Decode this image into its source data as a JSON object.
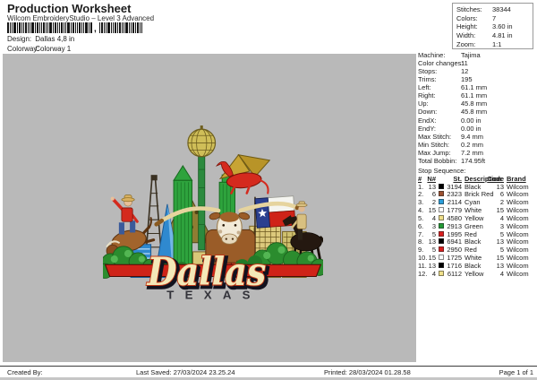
{
  "header": {
    "title": "Production Worksheet",
    "subtitle": "Wilcom EmbroideryStudio – Level 3 Advanced",
    "barcode_comma": ",",
    "design_label": "Design:",
    "design_value": "Dallas 4,8 in",
    "colorway_label": "Colorway:",
    "colorway_value": "Colorway 1"
  },
  "summary": {
    "rows": [
      {
        "label": "Stitches:",
        "value": "38344"
      },
      {
        "label": "Colors:",
        "value": "7"
      },
      {
        "label": "Height:",
        "value": "3.60 in"
      },
      {
        "label": "Width:",
        "value": "4.81 in"
      },
      {
        "label": "Zoom:",
        "value": "1:1"
      }
    ]
  },
  "machine": {
    "rows": [
      {
        "label": "Machine:",
        "value": "Tajima"
      },
      {
        "label": "Color changes:",
        "value": "11"
      },
      {
        "label": "Stops:",
        "value": "12"
      },
      {
        "label": "Trims:",
        "value": "195"
      },
      {
        "label": "Left:",
        "value": "61.1 mm"
      },
      {
        "label": "Right:",
        "value": "61.1 mm"
      },
      {
        "label": "Up:",
        "value": "45.8 mm"
      },
      {
        "label": "Down:",
        "value": "45.8 mm"
      },
      {
        "label": "EndX:",
        "value": "0.00 in"
      },
      {
        "label": "EndY:",
        "value": "0.00 in"
      },
      {
        "label": "Max Stitch:",
        "value": "9.4 mm"
      },
      {
        "label": "Min Stitch:",
        "value": "0.2 mm"
      },
      {
        "label": "Max Jump:",
        "value": "7.2 mm"
      },
      {
        "label": "Total Bobbin:",
        "value": "174.95ft"
      }
    ]
  },
  "stop_sequence": {
    "title": "Stop Sequence:",
    "headers": {
      "num": "#",
      "n": "N#",
      "st": "St.",
      "description": "Description",
      "code": "Code",
      "brand": "Brand"
    },
    "rows": [
      {
        "num": "1.",
        "n": "13",
        "hex": "#000000",
        "st": "3194",
        "description": "Black",
        "code": "13",
        "brand": "Wilcom"
      },
      {
        "num": "2.",
        "n": "6",
        "hex": "#9c5030",
        "st": "2323",
        "description": "Brick Red",
        "code": "6",
        "brand": "Wilcom"
      },
      {
        "num": "3.",
        "n": "2",
        "hex": "#2b9fdc",
        "st": "2114",
        "description": "Cyan",
        "code": "2",
        "brand": "Wilcom"
      },
      {
        "num": "4.",
        "n": "15",
        "hex": "#ffffff",
        "st": "1779",
        "description": "White",
        "code": "15",
        "brand": "Wilcom"
      },
      {
        "num": "5.",
        "n": "4",
        "hex": "#f0e08a",
        "st": "4580",
        "description": "Yellow",
        "code": "4",
        "brand": "Wilcom"
      },
      {
        "num": "6.",
        "n": "3",
        "hex": "#219a34",
        "st": "2913",
        "description": "Green",
        "code": "3",
        "brand": "Wilcom"
      },
      {
        "num": "7.",
        "n": "5",
        "hex": "#da1e1e",
        "st": "1995",
        "description": "Red",
        "code": "5",
        "brand": "Wilcom"
      },
      {
        "num": "8.",
        "n": "13",
        "hex": "#000000",
        "st": "6941",
        "description": "Black",
        "code": "13",
        "brand": "Wilcom"
      },
      {
        "num": "9.",
        "n": "5",
        "hex": "#da1e1e",
        "st": "2950",
        "description": "Red",
        "code": "5",
        "brand": "Wilcom"
      },
      {
        "num": "10.",
        "n": "15",
        "hex": "#ffffff",
        "st": "1725",
        "description": "White",
        "code": "15",
        "brand": "Wilcom"
      },
      {
        "num": "11.",
        "n": "13",
        "hex": "#000000",
        "st": "1716",
        "description": "Black",
        "code": "13",
        "brand": "Wilcom"
      },
      {
        "num": "12.",
        "n": "4",
        "hex": "#f0e08a",
        "st": "6112",
        "description": "Yellow",
        "code": "4",
        "brand": "Wilcom"
      }
    ]
  },
  "artwork": {
    "script_text": "Dallas",
    "subtext": "TEXAS",
    "canvas_color": "#b9b9b9"
  },
  "footer": {
    "created_by": "Created By:",
    "last_saved": "Last Saved: 27/03/2024 23.25.24",
    "printed": "Printed: 28/03/2024 01.28.58",
    "page": "Page 1 of 1"
  }
}
